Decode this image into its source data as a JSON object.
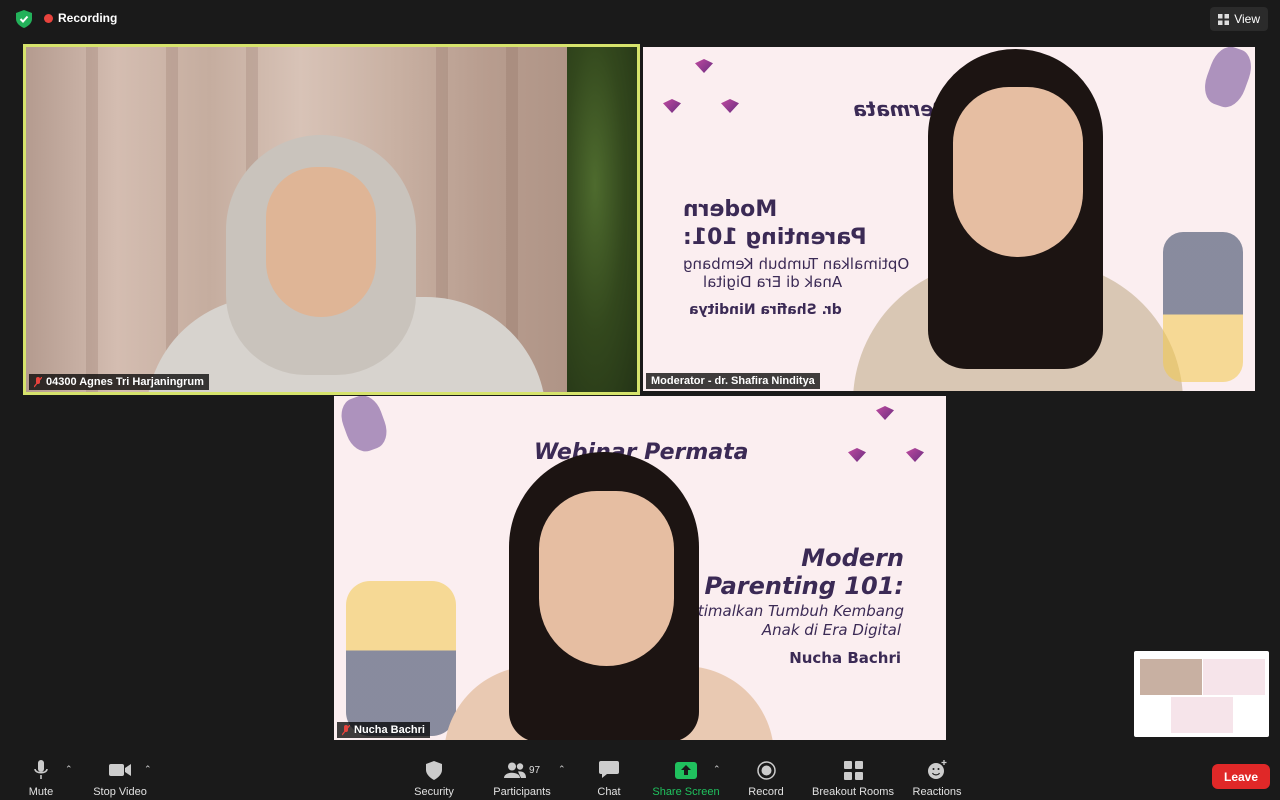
{
  "topbar": {
    "recording_label": "Recording",
    "view_label": "View"
  },
  "tiles": {
    "t1": {
      "name": "04300 Agnes Tri Harjaningrum"
    },
    "t2": {
      "name": "Moderator - dr. Shafira Ninditya",
      "slide": {
        "brand": "Permata",
        "title_line1": "Modern",
        "title_line2": "Parenting 101:",
        "subtitle_line1": "Optimalkan Tumbuh Kembang",
        "subtitle_line2": "Anak di Era Digital",
        "speaker": "dr. Shafira Ninditya"
      }
    },
    "t3": {
      "name": "Nucha Bachri",
      "slide": {
        "brand": "Webinar Permata",
        "title_line1": "Modern",
        "title_line2": "Parenting 101:",
        "subtitle_line1": "Optimalkan Tumbuh Kembang",
        "subtitle_line2": "Anak di Era Digital",
        "speaker": "Nucha Bachri"
      }
    }
  },
  "toolbar": {
    "mute": "Mute",
    "stop_video": "Stop Video",
    "security": "Security",
    "participants": "Participants",
    "participants_count": "97",
    "chat": "Chat",
    "share_screen": "Share Screen",
    "record": "Record",
    "breakout_rooms": "Breakout Rooms",
    "reactions": "Reactions",
    "leave": "Leave"
  },
  "colors": {
    "active_speaker_border": "#d6e36c",
    "share_green": "#20c15e",
    "leave_red": "#e02828",
    "recording_red": "#e8433d"
  },
  "icons": [
    "shield-icon",
    "view-grid-icon",
    "muted-mic-icon",
    "mic-icon",
    "video-icon",
    "security-shield-icon",
    "participants-icon",
    "chat-icon",
    "share-screen-icon",
    "record-icon",
    "breakout-rooms-icon",
    "reactions-icon"
  ]
}
